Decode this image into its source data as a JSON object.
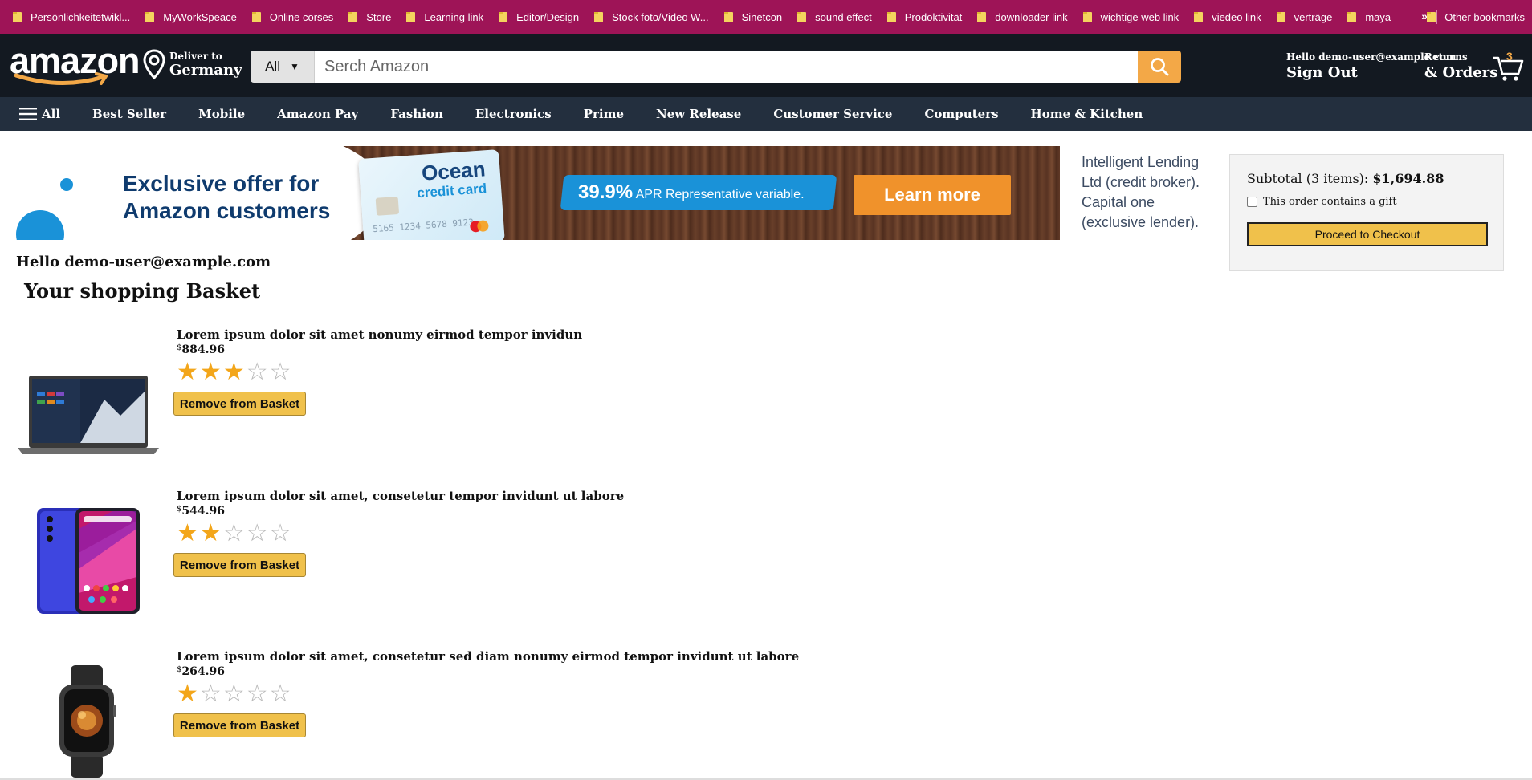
{
  "bookmarks": {
    "items": [
      "Persönlichkeitetwikl...",
      "MyWorkSpeace",
      "Online corses",
      "Store",
      "Learning link",
      "Editor/Design",
      "Stock foto/Video W...",
      "Sinetcon",
      "sound effect",
      "Prodoktivität",
      "downloader link",
      "wichtige web link",
      "viedeo link",
      "verträge",
      "maya"
    ],
    "more": "»",
    "other": "Other bookmarks"
  },
  "header": {
    "logo_text": "amazon",
    "deliver_small": "Deliver to",
    "deliver_big": "Germany",
    "search_category": "All",
    "search_placeholder": "Serch Amazon",
    "account_small": "Hello demo-user@example.com",
    "account_big": "Sign Out",
    "orders_small": "Returns",
    "orders_big": "& Orders",
    "cart_count": "3"
  },
  "nav": {
    "all_label": "All",
    "items": [
      "Best Seller",
      "Mobile",
      "Amazon Pay",
      "Fashion",
      "Electronics",
      "Prime",
      "New Release",
      "Customer Service",
      "Computers",
      "Home & Kitchen"
    ]
  },
  "banner": {
    "offer_line1": "Exclusive offer for",
    "offer_line2": "Amazon customers",
    "card_brand1": "Ocean",
    "card_brand2": "credit card",
    "card_numbers": "5165 1234 5678 9123",
    "apr_value": "39.9%",
    "apr_text": "APR Representative variable.",
    "cta": "Learn more",
    "side_text": "Intelligent Lending Ltd (credit broker). Capital one (exclusive lender)."
  },
  "subtotal": {
    "label": "Subtotal (3 items):",
    "amount": "$1,694.88",
    "gift_label": "This order contains a gift",
    "checkout_label": "Proceed to Checkout"
  },
  "basket": {
    "hello": "Hello demo-user@example.com",
    "title": "Your shopping Basket",
    "remove_label": "Remove from Basket",
    "items": [
      {
        "title": "Lorem ipsum dolor sit amet nonumy eirmod tempor invidun",
        "currency": "$",
        "price": "884.96",
        "rating": 3
      },
      {
        "title": "Lorem ipsum dolor sit amet, consetetur tempor invidunt ut labore",
        "currency": "$",
        "price": "544.96",
        "rating": 2
      },
      {
        "title": "Lorem ipsum dolor sit amet, consetetur sed diam nonumy eirmod tempor invidunt ut labore",
        "currency": "$",
        "price": "264.96",
        "rating": 1
      }
    ]
  },
  "colors": {
    "bookmarks_bg": "#9e1457",
    "header_bg": "#131921",
    "nav_bg": "#232f3e",
    "accent": "#f3a847",
    "button": "#f0c14b"
  }
}
